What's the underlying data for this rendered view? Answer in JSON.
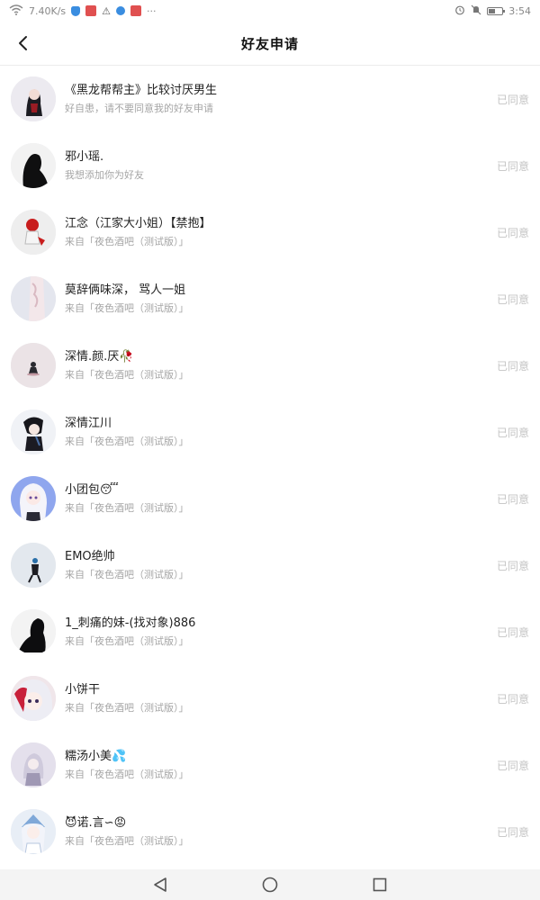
{
  "status_bar": {
    "speed": "7.40K/s",
    "time": "3:54",
    "more": "···"
  },
  "header": {
    "title": "好友申请"
  },
  "requests": [
    {
      "name": "《黑龙帮帮主》比较讨厌男生",
      "sub": "好自患，请不要同意我的好友申请",
      "status": "已同意"
    },
    {
      "name": "邪小瑶.",
      "sub": "我想添加你为好友",
      "status": "已同意"
    },
    {
      "name": "江念（江家大小姐）【禁抱】",
      "sub": "来自「夜色酒吧（测试版）」",
      "status": "已同意"
    },
    {
      "name": "莫辞俩味深， 骂人一姐",
      "sub": "来自「夜色酒吧（测试版）」",
      "status": "已同意"
    },
    {
      "name": "深情.颜.厌🥀",
      "sub": "来自「夜色酒吧（测试版）」",
      "status": "已同意"
    },
    {
      "name": "深情江川",
      "sub": "来自「夜色酒吧（测试版）」",
      "status": "已同意"
    },
    {
      "name": "小团包😴",
      "sub": "来自「夜色酒吧（测试版）」",
      "status": "已同意"
    },
    {
      "name": "EMO绝帅",
      "sub": "来自「夜色酒吧（测试版）」",
      "status": "已同意"
    },
    {
      "name": "1_刺痛的妹-(找对象)886",
      "sub": "来自「夜色酒吧（测试版）」",
      "status": "已同意"
    },
    {
      "name": "小饼干",
      "sub": "来自「夜色酒吧（测试版）」",
      "status": "已同意"
    },
    {
      "name": "糯汤小美💦",
      "sub": "来自「夜色酒吧（测试版）」",
      "status": "已同意"
    },
    {
      "name": "😈诺.言∽😡",
      "sub": "来自「夜色酒吧（测试版）」",
      "status": "已同意"
    }
  ]
}
